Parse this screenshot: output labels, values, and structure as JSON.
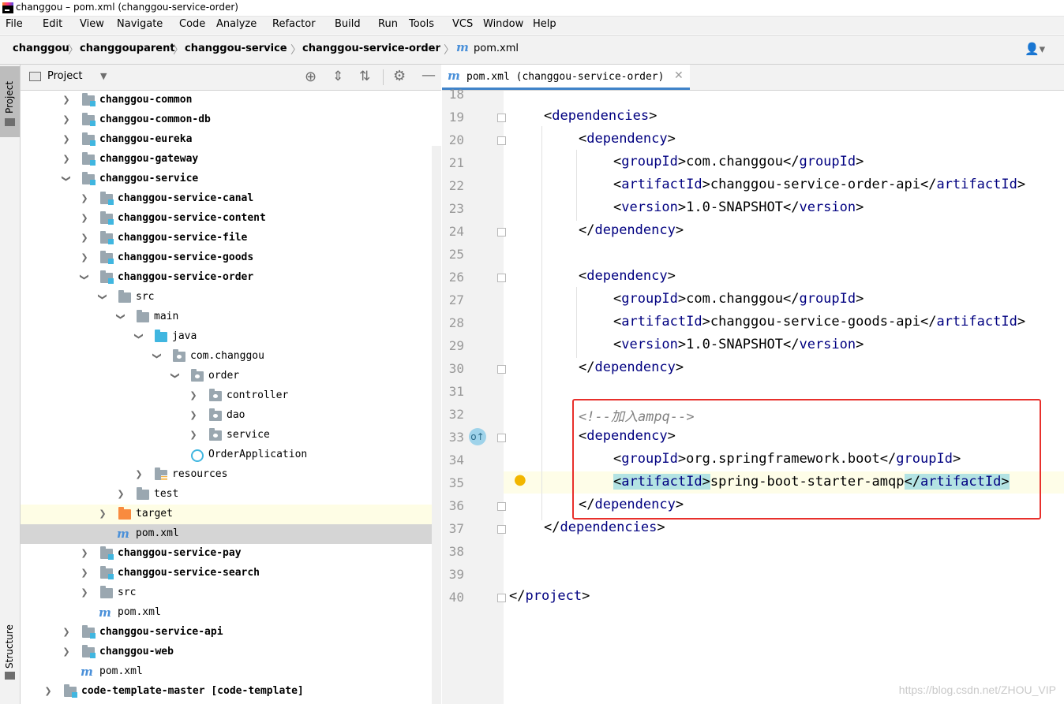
{
  "window": {
    "title": "changgou – pom.xml (changgou-service-order)"
  },
  "menu": [
    "File",
    "Edit",
    "View",
    "Navigate",
    "Code",
    "Analyze",
    "Refactor",
    "Build",
    "Run",
    "Tools",
    "VCS",
    "Window",
    "Help"
  ],
  "breadcrumbs": [
    "changgou",
    "changgouparent",
    "changgou-service",
    "changgou-service-order",
    "pom.xml"
  ],
  "side_stripe": {
    "top": "Project",
    "bottom": "Structure"
  },
  "project_panel": {
    "title": "Project"
  },
  "tree": [
    {
      "label": "changgou-common"
    },
    {
      "label": "changgou-common-db"
    },
    {
      "label": "changgou-eureka"
    },
    {
      "label": "changgou-gateway"
    },
    {
      "label": "changgou-service"
    },
    {
      "label": "changgou-service-canal"
    },
    {
      "label": "changgou-service-content"
    },
    {
      "label": "changgou-service-file"
    },
    {
      "label": "changgou-service-goods"
    },
    {
      "label": "changgou-service-order"
    },
    {
      "label": "src"
    },
    {
      "label": "main"
    },
    {
      "label": "java"
    },
    {
      "label": "com.changgou"
    },
    {
      "label": "order"
    },
    {
      "label": "controller"
    },
    {
      "label": "dao"
    },
    {
      "label": "service"
    },
    {
      "label": "OrderApplication"
    },
    {
      "label": "resources"
    },
    {
      "label": "test"
    },
    {
      "label": "target"
    },
    {
      "label": "pom.xml"
    },
    {
      "label": "changgou-service-pay"
    },
    {
      "label": "changgou-service-search"
    },
    {
      "label": "src"
    },
    {
      "label": "pom.xml"
    },
    {
      "label": "changgou-service-api"
    },
    {
      "label": "changgou-web"
    },
    {
      "label": "pom.xml"
    },
    {
      "label": "code-template-master [code-template]"
    }
  ],
  "editor": {
    "tab_label": "pom.xml (changgou-service-order)",
    "line_numbers": [
      "18",
      "19",
      "20",
      "21",
      "22",
      "23",
      "24",
      "25",
      "26",
      "27",
      "28",
      "29",
      "30",
      "31",
      "32",
      "33",
      "34",
      "35",
      "36",
      "37",
      "38",
      "39",
      "40"
    ],
    "tags": {
      "dependencies": "dependencies",
      "dependency": "dependency",
      "groupId": "groupId",
      "artifactId": "artifactId",
      "version": "version",
      "project": "project"
    },
    "values": {
      "group1": "com.changgou",
      "artifact1": "changgou-service-order-api",
      "version1": "1.0-SNAPSHOT",
      "group2": "com.changgou",
      "artifact2": "changgou-service-goods-api",
      "version2": "1.0-SNAPSHOT",
      "comment": "<!--加入ampq-->",
      "group3": "org.springframework.boot",
      "artifact3": "spring-boot-starter-amqp"
    }
  },
  "watermark": "https://blog.csdn.net/ZHOU_VIP"
}
